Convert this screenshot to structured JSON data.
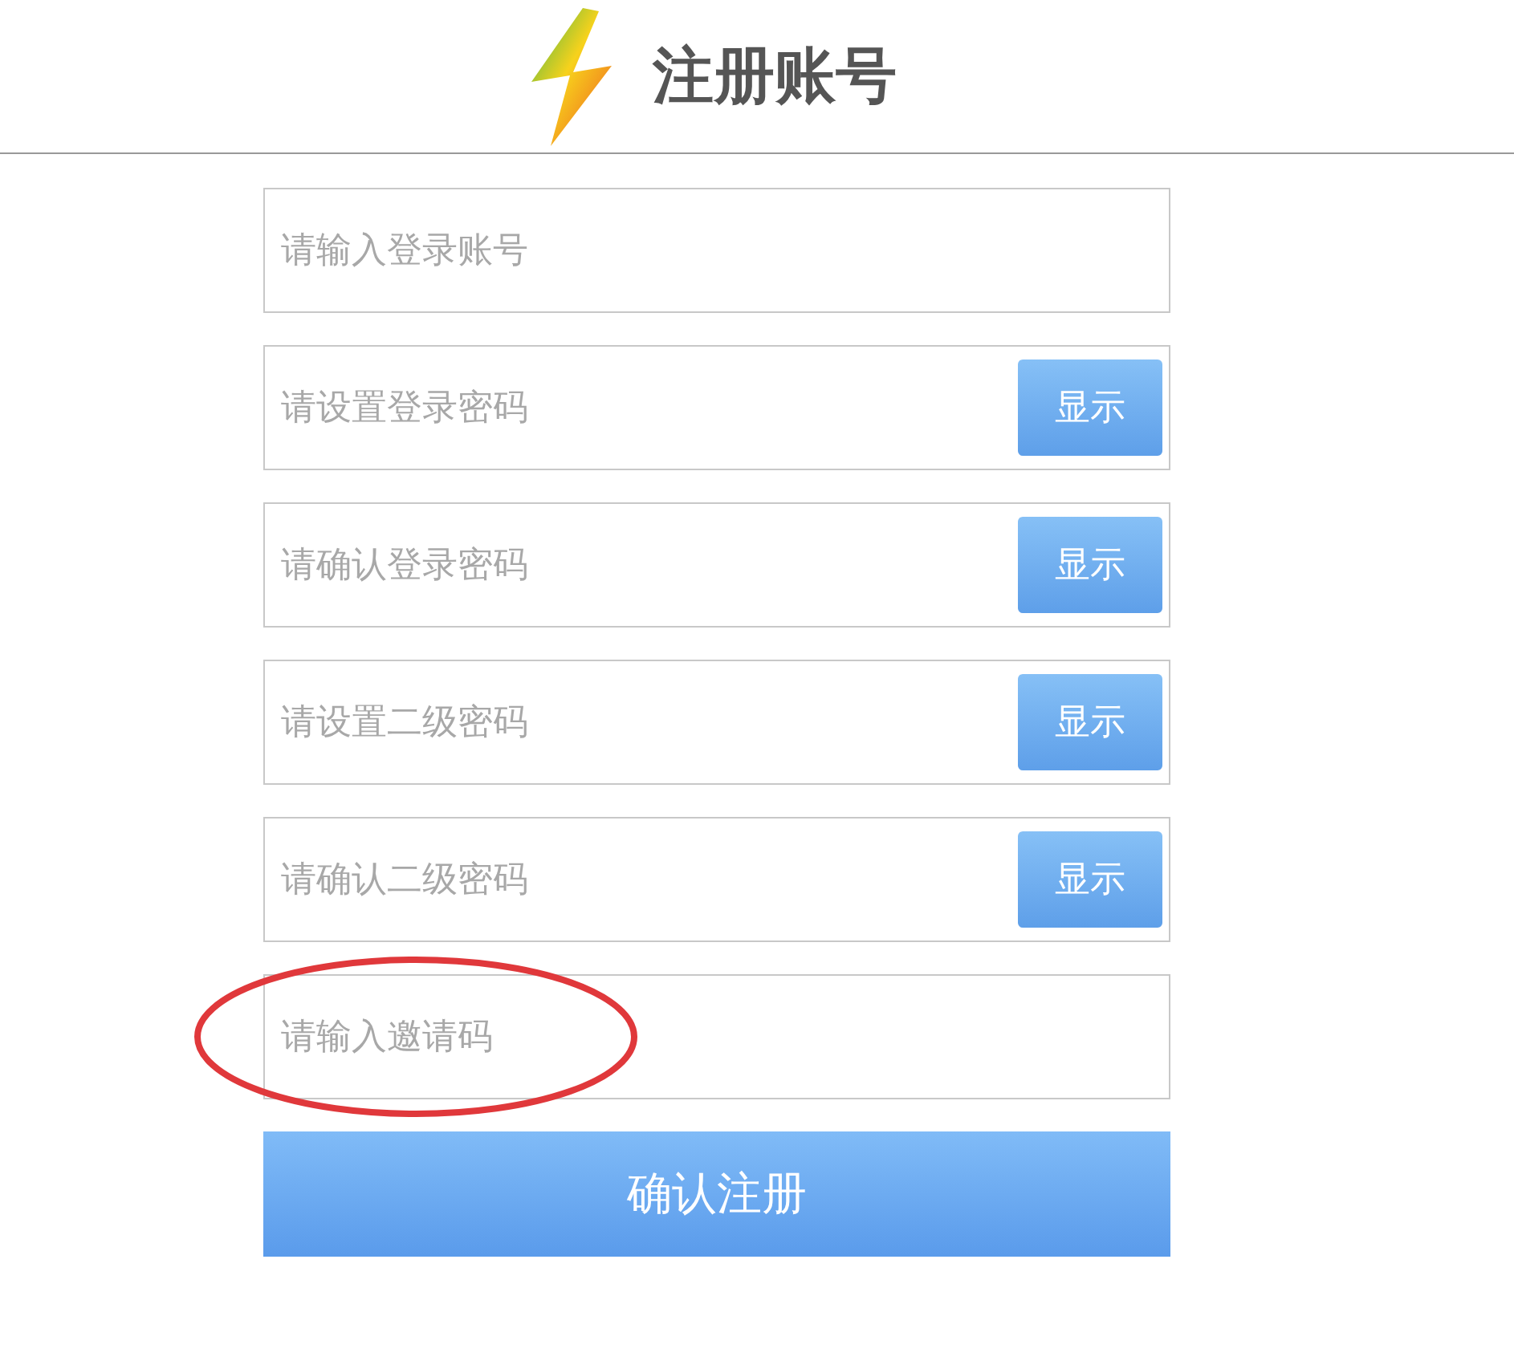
{
  "header": {
    "title": "注册账号"
  },
  "fields": [
    {
      "placeholder": "请输入登录账号",
      "highlighted": false
    },
    {
      "placeholder": "请设置登录密码",
      "toggle": "显示",
      "highlighted": false
    },
    {
      "placeholder": "请确认登录密码",
      "toggle": "显示",
      "highlighted": false
    },
    {
      "placeholder": "请设置二级密码",
      "toggle": "显示",
      "highlighted": false
    },
    {
      "placeholder": "请确认二级密码",
      "toggle": "显示",
      "highlighted": false
    },
    {
      "placeholder": "请输入邀请码",
      "highlighted": true
    }
  ],
  "submit": "确认注册"
}
